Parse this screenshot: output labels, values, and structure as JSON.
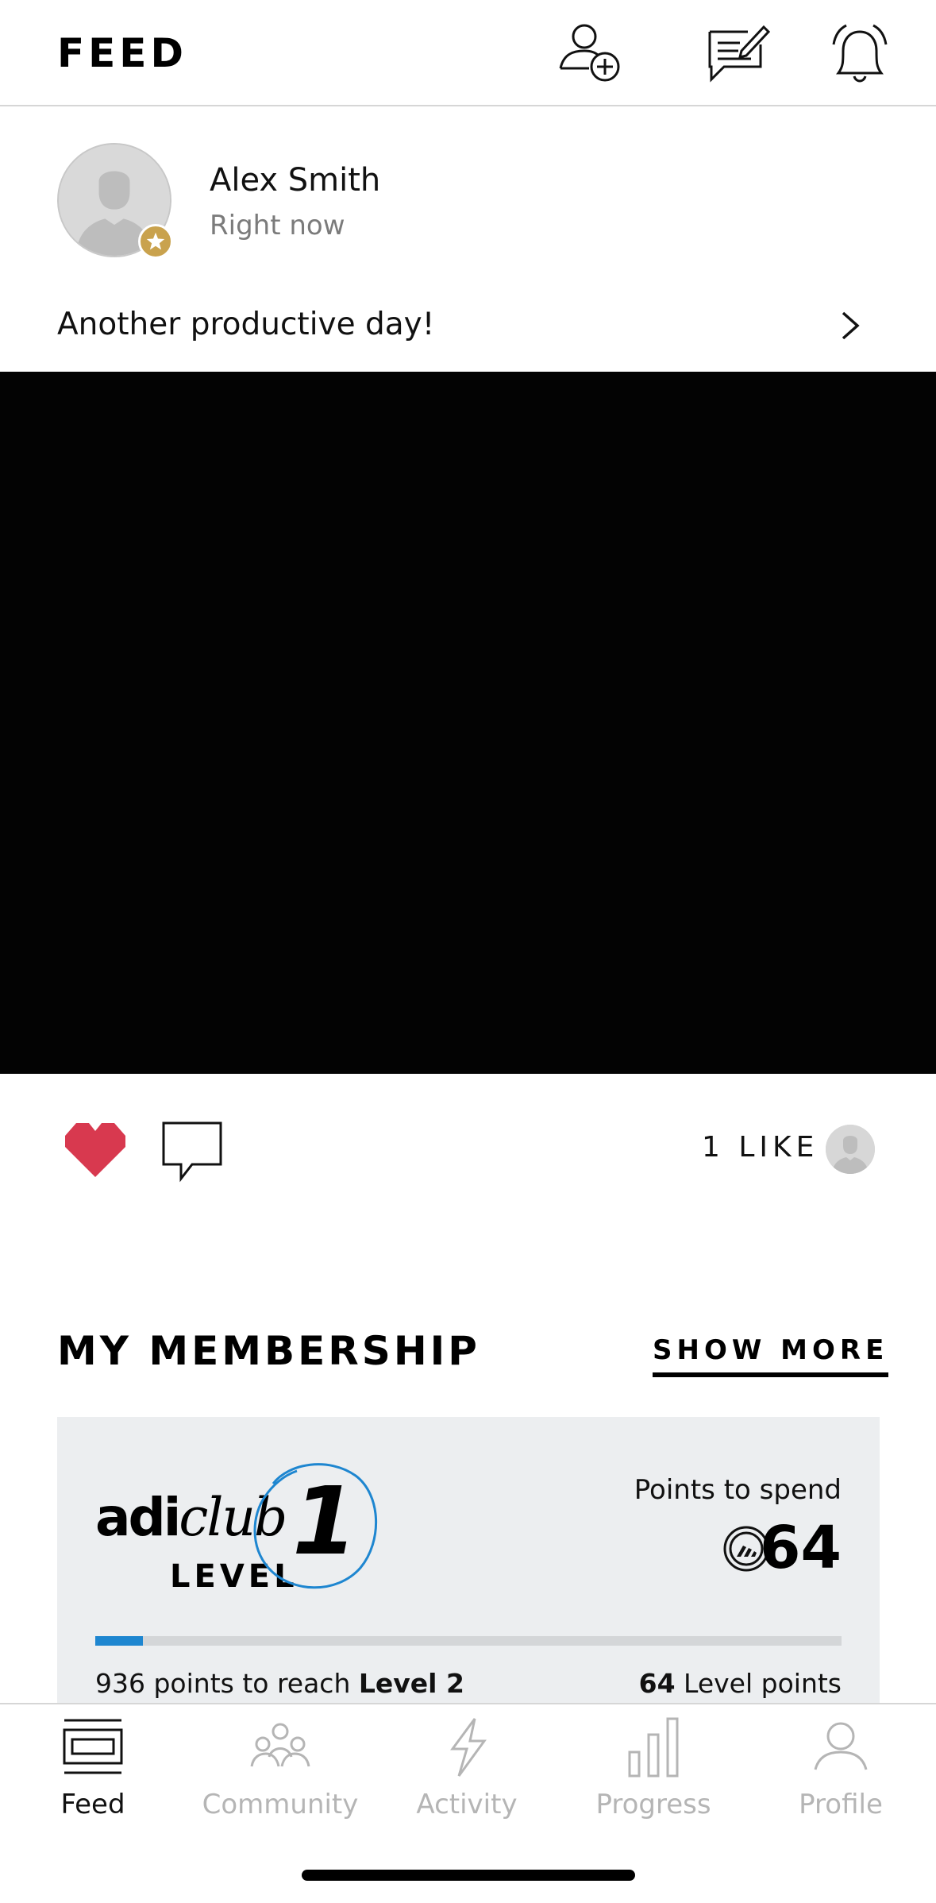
{
  "header": {
    "title": "FEED",
    "icons": [
      "add-friend-icon",
      "compose-post-icon",
      "notifications-icon"
    ]
  },
  "post": {
    "user_name": "Alex Smith",
    "time": "Right now",
    "text": "Another productive day!",
    "likes_text": "1 LIKE",
    "liked": true
  },
  "membership": {
    "section_title": "MY MEMBERSHIP",
    "show_more_label": "SHOW MORE",
    "logo_adi": "adi",
    "logo_club": "club",
    "level_label": "LEVEL",
    "level_number": "1",
    "points_to_spend_label": "Points to spend",
    "points_to_spend_value": "64",
    "progress_fraction": 0.064,
    "points_to_reach_prefix": "936 points to reach ",
    "points_to_reach_level": "Level 2",
    "level_points_value": "64",
    "level_points_suffix": " Level points",
    "progress_color": "#1e86d0"
  },
  "tabs": [
    {
      "label": "Feed",
      "icon": "feed-icon",
      "active": true
    },
    {
      "label": "Community",
      "icon": "community-icon",
      "active": false
    },
    {
      "label": "Activity",
      "icon": "activity-icon",
      "active": false
    },
    {
      "label": "Progress",
      "icon": "progress-icon",
      "active": false
    },
    {
      "label": "Profile",
      "icon": "profile-icon",
      "active": false
    }
  ],
  "colors": {
    "heart": "#d8394f",
    "badge": "#c9a24d",
    "card_bg": "#eceef0"
  }
}
